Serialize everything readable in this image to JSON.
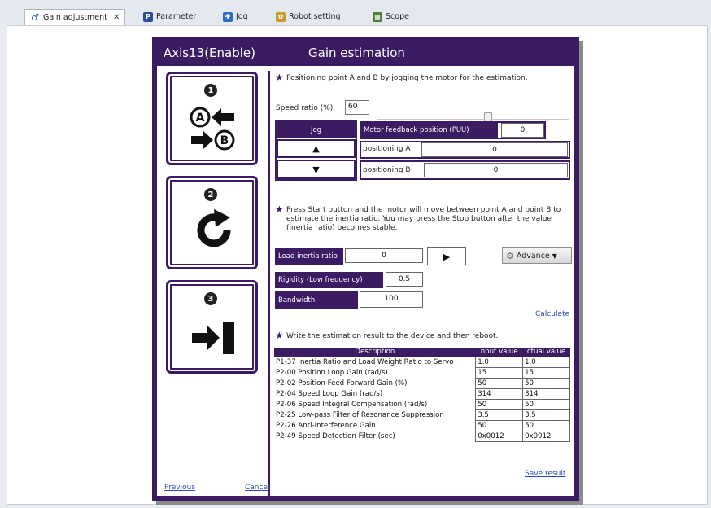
{
  "tabs": [
    {
      "label": "Gain adjustment",
      "icon": "gain-adjustment-icon",
      "active": true
    },
    {
      "label": "Parameter",
      "icon": "parameter-icon",
      "active": false
    },
    {
      "label": "Jog",
      "icon": "jog-icon",
      "active": false
    },
    {
      "label": "Robot setting",
      "icon": "robot-setting-icon",
      "active": false
    },
    {
      "label": "Scope",
      "icon": "scope-icon",
      "active": false
    }
  ],
  "dialog": {
    "axis": "Axis13(Enable)",
    "title": "Gain estimation",
    "step_numbers": [
      "1",
      "2",
      "3"
    ],
    "step1_instruction": "Positioning point A and B by jogging the motor for the estimation.",
    "speed_ratio_label": "Speed ratio (%)",
    "speed_ratio_value": "60",
    "jog_label": "Jog",
    "jog_up": "▲",
    "jog_down": "▼",
    "motor_feedback_label": "Motor feedback position (PUU)",
    "motor_feedback_value": "0",
    "positioning_a_label": "positioning A",
    "positioning_a_value": "0",
    "positioning_b_label": "positioning B",
    "positioning_b_value": "0",
    "step2_instruction": "Press Start button and the motor will move between point A and point B to estimate the inertia ratio. You may press the Stop button after the value (inertia ratio) becomes stable.",
    "load_inertia_label": "Load inertia ratio",
    "load_inertia_value": "0",
    "start_button": "▶",
    "advance_label": "Advance",
    "rigidity_label": "Rigidity (Low frequency)",
    "rigidity_value": "0.5",
    "bandwidth_label": "Bandwidth",
    "bandwidth_value": "100",
    "calculate_label": "Calculate",
    "step3_instruction": "Write the estimation result to the device and then reboot.",
    "table": {
      "headers": [
        "Description",
        "nput value",
        "ctual value"
      ],
      "rows": [
        [
          "P1-37 Inertia Ratio and Load Weight Ratio to Servo",
          "1.0",
          "1.0"
        ],
        [
          "P2-00 Position Loop Gain (rad/s)",
          "15",
          "15"
        ],
        [
          "P2-02 Position Feed Forward Gain (%)",
          "50",
          "50"
        ],
        [
          "P2-04 Speed Loop Gain (rad/s)",
          "314",
          "314"
        ],
        [
          "P2-06 Speed Integral Compensation (rad/s)",
          "50",
          "50"
        ],
        [
          "P2-25 Low-pass Filter of Resonance Suppression",
          "3.5",
          "3.5"
        ],
        [
          "P2-26 Anti-Interference Gain",
          "50",
          "50"
        ],
        [
          "P2-49 Speed Detection Filter (sec)",
          "0x0012",
          "0x0012"
        ]
      ]
    },
    "save_result_label": "Save result",
    "previous_label": "Previous",
    "cancel_label": "Cancel"
  },
  "colors": {
    "accent": "#3b1c63",
    "link": "#2d4bb5"
  }
}
